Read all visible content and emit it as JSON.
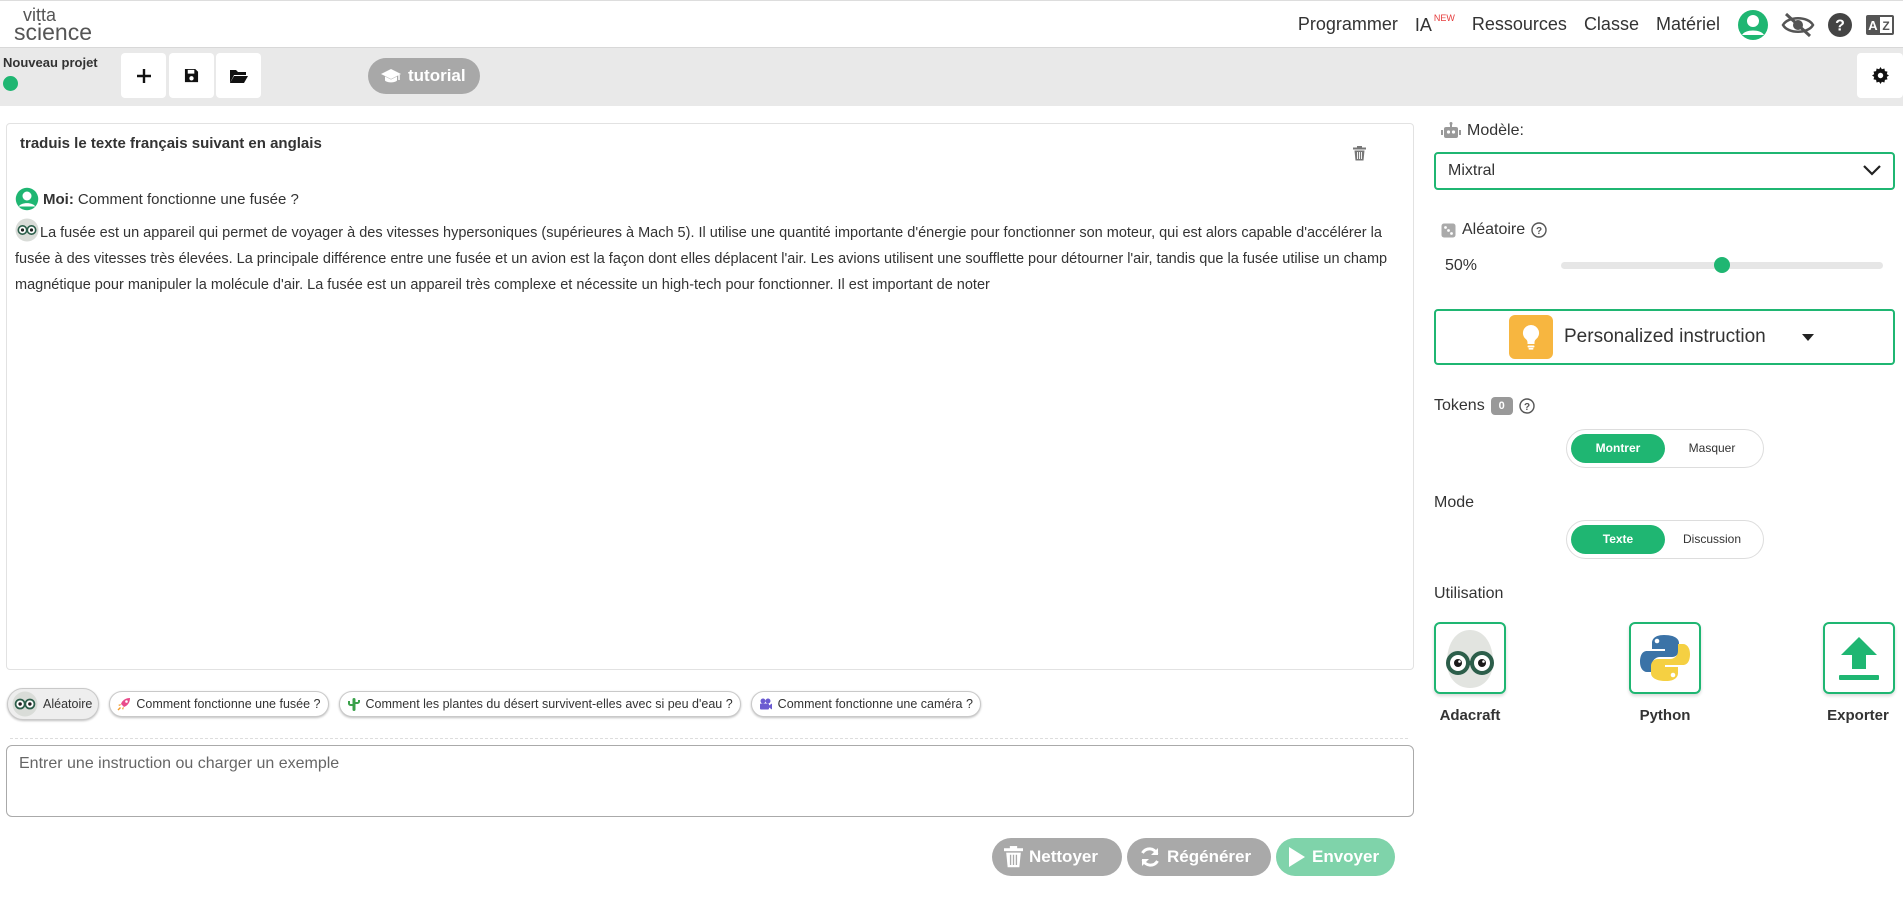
{
  "logo": {
    "line1": "vitta",
    "line2": "science"
  },
  "nav": {
    "programmer": "Programmer",
    "ia": "IA",
    "ia_badge": "NEW",
    "ressources": "Ressources",
    "classe": "Classe",
    "materiel": "Matériel"
  },
  "toolbar": {
    "project_name": "Nouveau projet",
    "tutorial_label": "tutorial"
  },
  "chat": {
    "title": "traduis le texte français suivant en anglais",
    "user_label": "Moi:",
    "user_message": "Comment fonctionne une fusée ?",
    "bot_message": "La fusée est un appareil qui permet de voyager à des vitesses hypersoniques (supérieures à Mach 5). Il utilise une quantité importante d'énergie pour fonctionner son moteur, qui est alors capable d'accélérer la fusée à des vitesses très élevées. La principale différence entre une fusée et un avion est la façon dont elles déplacent l'air. Les avions utilisent une soufflette pour détourner l'air, tandis que la fusée utilise un champ magnétique pour manipuler la molécule d'air. La fusée est un appareil très complexe et nécessite un high-tech pour fonctionner. Il est important de noter"
  },
  "examples": [
    {
      "label": "Aléatoire"
    },
    {
      "label": "Comment fonctionne une fusée ?"
    },
    {
      "label": "Comment les plantes du désert survivent-elles avec si peu d'eau ?"
    },
    {
      "label": "Comment fonctionne une caméra ?"
    }
  ],
  "input": {
    "placeholder": "Entrer une instruction ou charger un exemple",
    "value": ""
  },
  "actions": {
    "clean": "Nettoyer",
    "regenerate": "Régénérer",
    "send": "Envoyer"
  },
  "settings": {
    "model_label": "Modèle:",
    "model_value": "Mixtral",
    "random_label": "Aléatoire",
    "random_value_text": "50%",
    "random_value": 0.5,
    "personalized_label": "Personalized instruction",
    "tokens_label": "Tokens",
    "tokens_count": "0",
    "tokens_options": [
      "Montrer",
      "Masquer"
    ],
    "tokens_selected": "Montrer",
    "mode_label": "Mode",
    "mode_options": [
      "Texte",
      "Discussion"
    ],
    "mode_selected": "Texte",
    "usage_label": "Utilisation",
    "usage_items": [
      {
        "label": "Adacraft"
      },
      {
        "label": "Python"
      },
      {
        "label": "Exporter"
      }
    ]
  },
  "colors": {
    "accent": "#1fb672",
    "toolbar_bg": "#e9e9e9",
    "button_gray": "#a9a9a9",
    "send_button": "#7fd3aa",
    "bulb_bg": "#f7b640",
    "new_badge": "#e53b3b"
  }
}
